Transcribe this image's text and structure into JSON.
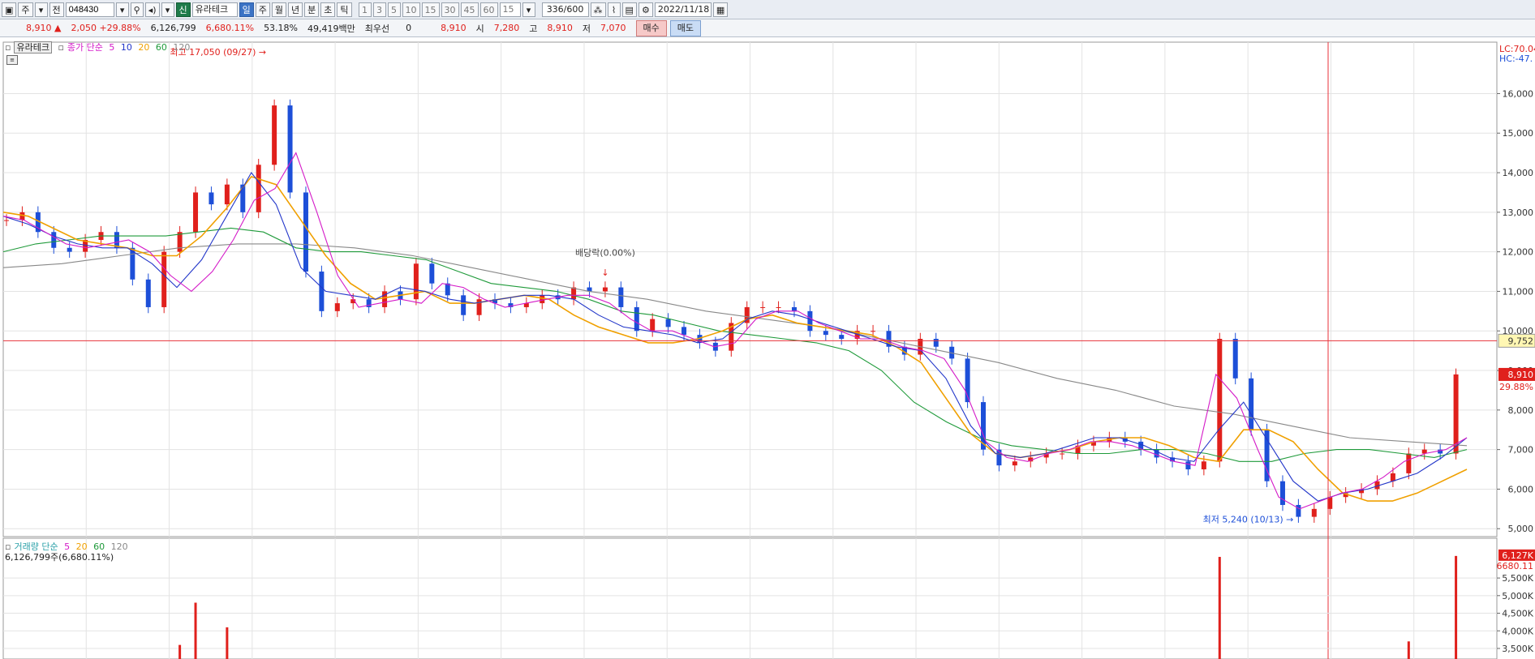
{
  "toolbar": {
    "market_type": "주",
    "mode": "전",
    "code": "048430",
    "search_icon": "search-icon",
    "sound_icon": "speaker-icon",
    "credit_badge": "신",
    "stock_name": "유라테크",
    "periods": [
      "일",
      "주",
      "월",
      "년",
      "분",
      "초",
      "틱"
    ],
    "active_period": "일",
    "intervals": [
      "1",
      "3",
      "5",
      "10",
      "15",
      "30",
      "45",
      "60"
    ],
    "interval_value": "15",
    "count": "336/600",
    "date": "2022/11/18"
  },
  "quote": {
    "price": "8,910",
    "change": "2,050",
    "change_pct": "+29.88%",
    "volume": "6,126,799",
    "volume_ratio": "6,680.11%",
    "turnover": "53.18%",
    "amount": "49,419백만",
    "best_label": "최우선",
    "best_qty": "0",
    "best_price": "8,910",
    "open_label": "시",
    "open": "7,280",
    "high_label": "고",
    "high": "8,910",
    "low_label": "저",
    "low": "7,070",
    "buy_label": "매수",
    "sell_label": "매도"
  },
  "price_legend": {
    "name": "유라테크",
    "series": "종가 단순",
    "ma": [
      "5",
      "10",
      "20",
      "60",
      "120"
    ]
  },
  "volume_legend": {
    "series": "거래량 단순",
    "ma": [
      "5",
      "20",
      "60",
      "120"
    ],
    "value": "6,126,799주(6,680.11%)"
  },
  "colors": {
    "up": "#e0201c",
    "down": "#1d4fd8",
    "ma5": "#d41ac8",
    "ma10": "#2236c9",
    "ma20": "#f0a000",
    "ma60": "#1f9a3a",
    "ma120": "#888888",
    "crosshair": "#e8323a"
  },
  "chart_data": {
    "type": "candlestick",
    "period": "daily",
    "price_axis": {
      "range": [
        4800,
        17300
      ],
      "ticks": [
        "5,000",
        "6,000",
        "7,000",
        "8,000",
        "9,000",
        "10,000",
        "11,000",
        "12,000",
        "13,000",
        "14,000",
        "15,000",
        "16,000"
      ],
      "top_labels": [
        "LC:70.04",
        "HC:-47."
      ]
    },
    "annotations": {
      "high": {
        "text": "최고 17,050 (09/27)",
        "value": 17050
      },
      "low": {
        "text": "최저 5,240 (10/13)",
        "value": 5240
      },
      "ex_dividend": {
        "text": "배당락(0.00%)"
      }
    },
    "crosshair_value": "9,752",
    "current_price_label": "8,910",
    "current_pct_label": "29.88%",
    "close_path": [
      12800,
      13000,
      12500,
      12100,
      12000,
      12300,
      12500,
      12100,
      11300,
      10600,
      12000,
      12500,
      13500,
      13200,
      13700,
      13000,
      14200,
      15700,
      13500,
      11500,
      10500,
      10700,
      10800,
      10600,
      11000,
      10800,
      11700,
      11200,
      10900,
      10400,
      10800,
      10700,
      10600,
      10700,
      10900,
      10800,
      11100,
      11000,
      11100,
      10600,
      10000,
      10300,
      10100,
      9900,
      9700,
      9500,
      10200,
      10600,
      10600,
      10600,
      10500,
      10000,
      9900,
      9800,
      10000,
      10000,
      9600,
      9400,
      9800,
      9600,
      9300,
      8200,
      7000,
      6600,
      6700,
      6800,
      6900,
      6900,
      7100,
      7200,
      7300,
      7200,
      7000,
      6800,
      6700,
      6500,
      6700,
      9800,
      8800,
      7500,
      6200,
      5600,
      5300,
      5500,
      5800,
      5900,
      6000,
      6200,
      6400,
      6900,
      7000,
      6900,
      8900
    ],
    "ma5": [
      12900,
      12800,
      12500,
      12200,
      12100,
      12200,
      12300,
      12000,
      11400,
      11000,
      11500,
      12300,
      13300,
      13600,
      14500,
      13000,
      11400,
      10600,
      10700,
      10800,
      10700,
      11200,
      11100,
      10800,
      10600,
      10700,
      10800,
      10900,
      10900,
      10700,
      10300,
      10000,
      10000,
      9800,
      9600,
      9700,
      10300,
      10500,
      10500,
      10200,
      10000,
      9800,
      9800,
      9600,
      9500,
      9300,
      8500,
      7200,
      6800,
      6700,
      6900,
      7000,
      7200,
      7200,
      7100,
      6900,
      6700,
      6600,
      8900,
      8300,
      7000,
      5800,
      5500,
      5700,
      5900,
      6000,
      6300,
      6700,
      6900,
      7000,
      7300
    ],
    "ma10": [
      12900,
      12700,
      12400,
      12200,
      12100,
      12100,
      11700,
      11100,
      11800,
      12900,
      14000,
      13200,
      11600,
      11000,
      10900,
      10800,
      11100,
      11000,
      10800,
      10700,
      10800,
      10900,
      10900,
      10800,
      10400,
      10100,
      10000,
      9900,
      9700,
      9800,
      10300,
      10500,
      10400,
      10200,
      10000,
      9800,
      9600,
      9500,
      8800,
      7600,
      6900,
      6800,
      6900,
      7100,
      7300,
      7300,
      7100,
      6800,
      6700,
      7500,
      8200,
      7200,
      6200,
      5700,
      5900,
      6000,
      6200,
      6400,
      6800,
      7300
    ],
    "ma20": [
      13000,
      12900,
      12600,
      12300,
      12200,
      12100,
      11900,
      11900,
      12400,
      13100,
      13900,
      13700,
      12800,
      11900,
      11200,
      10800,
      10900,
      11000,
      10700,
      10700,
      10800,
      10900,
      10800,
      10400,
      10100,
      9900,
      9700,
      9700,
      9800,
      10000,
      10300,
      10400,
      10200,
      10100,
      10000,
      9900,
      9600,
      9200,
      8300,
      7400,
      6900,
      6800,
      6900,
      7000,
      7200,
      7300,
      7300,
      7100,
      6800,
      6700,
      7500,
      7500,
      7200,
      6500,
      5900,
      5700,
      5700,
      5900,
      6200,
      6500
    ],
    "ma60": [
      12000,
      12200,
      12300,
      12400,
      12400,
      12400,
      12500,
      12600,
      12500,
      12100,
      12000,
      12000,
      11900,
      11800,
      11500,
      11200,
      11100,
      11000,
      10800,
      10500,
      10400,
      10200,
      10000,
      9900,
      9800,
      9700,
      9500,
      9000,
      8200,
      7700,
      7300,
      7100,
      7000,
      6900,
      6900,
      7000,
      7000,
      6900,
      6700,
      6700,
      6900,
      7000,
      7000,
      6900,
      6800,
      7000
    ],
    "ma120": [
      11600,
      11700,
      11900,
      12100,
      12200,
      12200,
      12100,
      11900,
      11600,
      11300,
      11000,
      10800,
      10500,
      10300,
      10100,
      9800,
      9500,
      9200,
      8800,
      8500,
      8100,
      7900,
      7600,
      7300,
      7200,
      7100
    ],
    "volume_axis": {
      "ticks": [
        "3,500K",
        "4,000K",
        "4,500K",
        "5,000K",
        "5,500K"
      ],
      "current_label": "6,127K",
      "current_pct_label": "6680.11"
    },
    "volume_spikes": [
      {
        "value": 3600000,
        "dir": "up"
      },
      {
        "value": 4800000,
        "dir": "up"
      },
      {
        "value": 4100000,
        "dir": "up"
      },
      {
        "value": 6100000,
        "dir": "up"
      },
      {
        "value": 3700000,
        "dir": "up"
      },
      {
        "value": 6127000,
        "dir": "up"
      }
    ]
  }
}
